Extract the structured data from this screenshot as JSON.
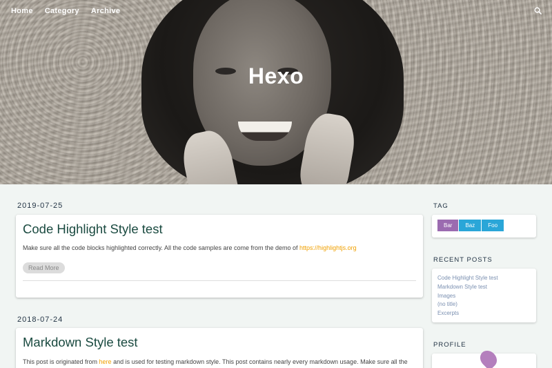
{
  "nav": {
    "items": [
      "Home",
      "Category",
      "Archive"
    ],
    "search_icon": "search-icon"
  },
  "hero": {
    "title": "Hexo"
  },
  "posts": [
    {
      "date": "2019-07-25",
      "title": "Code Highlight Style test",
      "excerpt": "Make sure all the code blocks highlighted correctly. All the code samples are come from the demo of ",
      "link": "https://highlightjs.org",
      "read_more": "Read More"
    },
    {
      "date": "2018-07-24",
      "title": "Markdown Style test",
      "excerpt_before": "This post is originated from ",
      "link": "here",
      "excerpt_after": " and is used for testing markdown style. This post contains nearly every markdown usage. Make sure all the"
    }
  ],
  "sidebar": {
    "tag_title": "TAG",
    "tags": [
      {
        "label": "Bar",
        "color": "#9b6bb0"
      },
      {
        "label": "Baz",
        "color": "#2aa6d8"
      },
      {
        "label": "Foo",
        "color": "#2aa6d8"
      }
    ],
    "recent_title": "RECENT POSTS",
    "recent": [
      "Code Highlight Style test",
      "Markdown Style test",
      "Images",
      "(no title)",
      "Excerpts"
    ],
    "profile_title": "PROFILE"
  },
  "colors": {
    "accent_link": "#f0a000",
    "title": "#1a4a40",
    "background": "#f1f5f3"
  }
}
